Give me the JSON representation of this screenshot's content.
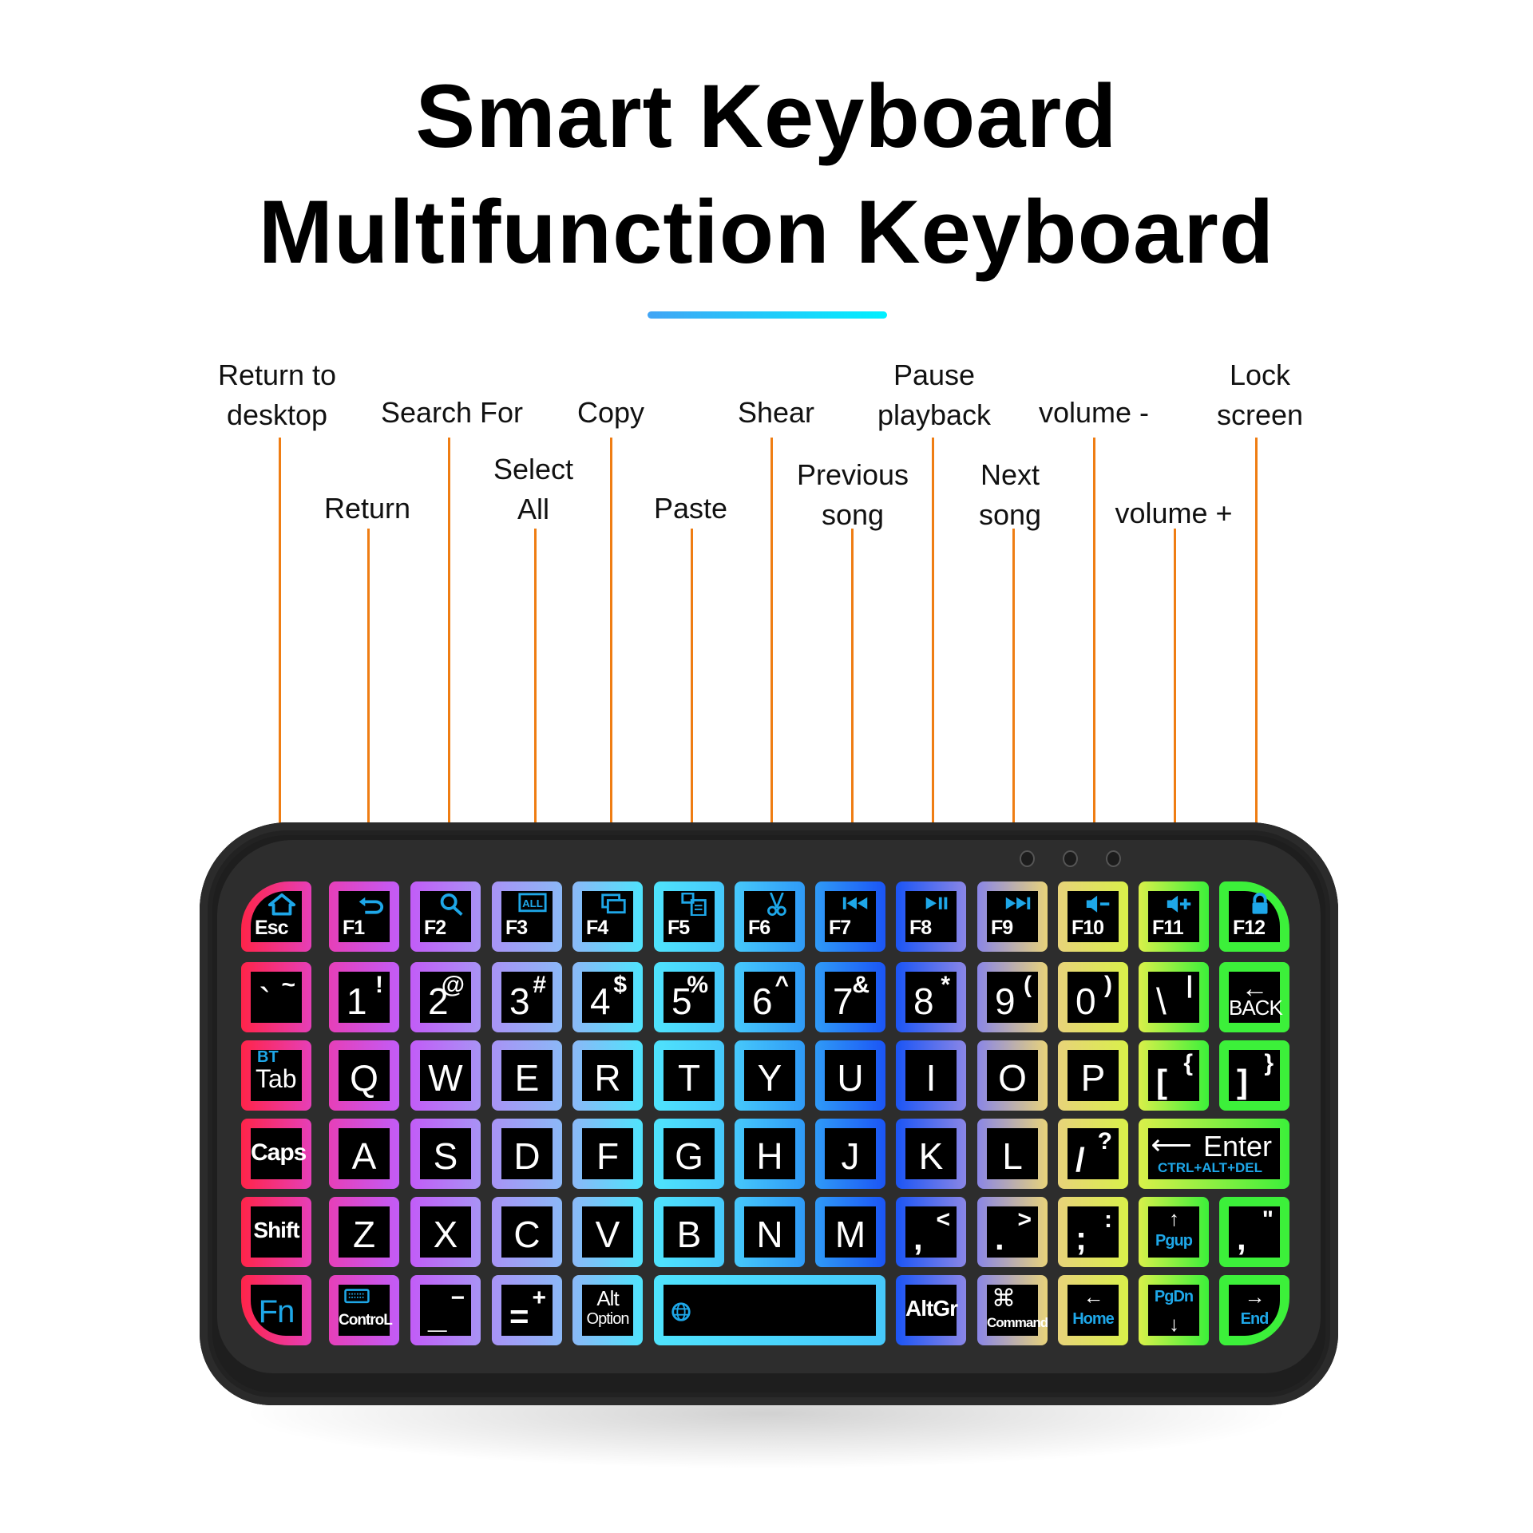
{
  "header": {
    "title_line1": "Smart Keyboard",
    "title_line2": "Multifunction Keyboard",
    "accent_gradient": [
      "#42a5f5",
      "#00f0ff"
    ]
  },
  "callouts": [
    {
      "key": "Esc",
      "lines": [
        "Return to",
        "desktop"
      ]
    },
    {
      "key": "F1",
      "lines": [
        "Return"
      ]
    },
    {
      "key": "F2",
      "lines": [
        "Search For"
      ]
    },
    {
      "key": "F3",
      "lines": [
        "Select",
        "All"
      ]
    },
    {
      "key": "F4",
      "lines": [
        "Copy"
      ]
    },
    {
      "key": "F5",
      "lines": [
        "Paste"
      ]
    },
    {
      "key": "F6",
      "lines": [
        "Shear"
      ]
    },
    {
      "key": "F7",
      "lines": [
        "Previous",
        "song"
      ]
    },
    {
      "key": "F8",
      "lines": [
        "Pause",
        "playback"
      ]
    },
    {
      "key": "F9",
      "lines": [
        "Next",
        "song"
      ]
    },
    {
      "key": "F10",
      "lines": [
        "volume -"
      ]
    },
    {
      "key": "F11",
      "lines": [
        "volume +"
      ]
    },
    {
      "key": "F12",
      "lines": [
        "Lock",
        "screen"
      ]
    }
  ],
  "leader_color": "#ef7d13",
  "column_colors": [
    "#ff2449",
    "#e63fb8",
    "#c25cf7",
    "#a893f5",
    "#8bb8f7",
    "#4fe3fc",
    "#46c8fb",
    "#2f9af7",
    "#1b55f5",
    "#8a86e6",
    "#e8d37a",
    "#d9f04a",
    "#3cf03a"
  ],
  "keyboard": {
    "function_row": [
      {
        "label": "Esc",
        "icon": "home-icon"
      },
      {
        "label": "F1",
        "icon": "return-arrow-icon"
      },
      {
        "label": "F2",
        "icon": "search-icon"
      },
      {
        "label": "F3",
        "icon": "select-all-icon",
        "icon_text": "ALL"
      },
      {
        "label": "F4",
        "icon": "copy-icon"
      },
      {
        "label": "F5",
        "icon": "paste-icon"
      },
      {
        "label": "F6",
        "icon": "scissors-icon"
      },
      {
        "label": "F7",
        "icon": "previous-track-icon"
      },
      {
        "label": "F8",
        "icon": "play-pause-icon"
      },
      {
        "label": "F9",
        "icon": "next-track-icon"
      },
      {
        "label": "F10",
        "icon": "volume-down-icon"
      },
      {
        "label": "F11",
        "icon": "volume-up-icon"
      },
      {
        "label": "F12",
        "icon": "lock-icon"
      }
    ],
    "number_row": [
      {
        "main": "`",
        "shift": "~"
      },
      {
        "main": "1",
        "shift": "!"
      },
      {
        "main": "2",
        "shift": "@"
      },
      {
        "main": "3",
        "shift": "#"
      },
      {
        "main": "4",
        "shift": "$"
      },
      {
        "main": "5",
        "shift": "%"
      },
      {
        "main": "6",
        "shift": "^"
      },
      {
        "main": "7",
        "shift": "&"
      },
      {
        "main": "8",
        "shift": "*"
      },
      {
        "main": "9",
        "shift": "("
      },
      {
        "main": "0",
        "shift": ")"
      },
      {
        "main": "\\",
        "shift": "|"
      },
      {
        "main": "BACK",
        "shift": "←"
      }
    ],
    "top_row": [
      {
        "main": "Tab",
        "fn": "BT"
      },
      {
        "main": "Q"
      },
      {
        "main": "W"
      },
      {
        "main": "E"
      },
      {
        "main": "R"
      },
      {
        "main": "T"
      },
      {
        "main": "Y"
      },
      {
        "main": "U"
      },
      {
        "main": "I"
      },
      {
        "main": "O"
      },
      {
        "main": "P"
      },
      {
        "main": "[",
        "shift": "{"
      },
      {
        "main": "]",
        "shift": "}"
      }
    ],
    "home_row": [
      {
        "main": "Caps"
      },
      {
        "main": "A"
      },
      {
        "main": "S"
      },
      {
        "main": "D"
      },
      {
        "main": "F"
      },
      {
        "main": "G"
      },
      {
        "main": "H"
      },
      {
        "main": "J"
      },
      {
        "main": "K"
      },
      {
        "main": "L"
      },
      {
        "main": "/",
        "shift": "?"
      },
      {
        "main": "Enter",
        "fn": "CTRL+ALT+DEL"
      }
    ],
    "bottom_row": [
      {
        "main": "Shift"
      },
      {
        "main": "Z"
      },
      {
        "main": "X"
      },
      {
        "main": "C"
      },
      {
        "main": "V"
      },
      {
        "main": "B"
      },
      {
        "main": "N"
      },
      {
        "main": "M"
      },
      {
        "main": ",",
        "shift": "<"
      },
      {
        "main": ".",
        "shift": ">"
      },
      {
        "main": ";",
        "shift": ":"
      },
      {
        "main": "↑",
        "fn": "Pgup"
      },
      {
        "main": ",",
        "shift": "\""
      }
    ],
    "modifier_row": [
      {
        "main": "Fn"
      },
      {
        "main": "ControL",
        "icon": "keyboard-icon"
      },
      {
        "main": "_",
        "shift": "−"
      },
      {
        "main": "=",
        "shift": "+"
      },
      {
        "main": "Alt",
        "sub": "Option"
      },
      {
        "main": "",
        "icon": "globe-icon"
      },
      {
        "main": "AltGr"
      },
      {
        "main": "Command",
        "icon": "command-icon",
        "icon_text": "⌘"
      },
      {
        "main": "←",
        "fn": "Home"
      },
      {
        "main": "↓",
        "fn": "PgDn"
      },
      {
        "main": "→",
        "fn": "End"
      }
    ]
  }
}
